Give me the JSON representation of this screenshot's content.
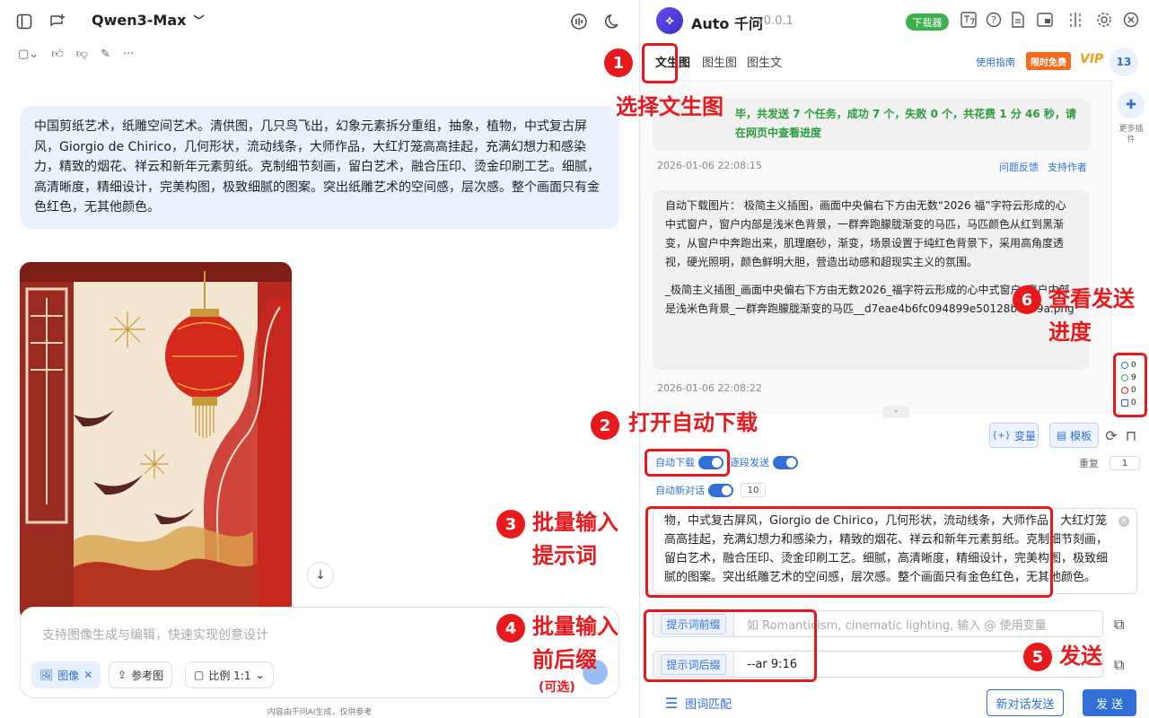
{
  "left": {
    "model": "Qwen3-Max",
    "user_prompt": "中国剪纸艺术，纸雕空间艺术。清供图，几只鸟飞出，幻象元素拆分重组，抽象，植物，中式复古屏风，Giorgio de Chirico，几何形状，流动线条，大师作品，大红灯笼高高挂起，充满幻想力和感染力，精致的烟花、祥云和新年元素剪纸。克制细节刻画，留白艺术，融合压印、烫金印刷工艺。细腻，高清晰度，精细设计，完美构图，极致细腻的图案。突出纸雕艺术的空间感，层次感。整个画面只有金色红色，无其他颜色。",
    "composer_placeholder": "支持图像生成与编辑，快速实现创意设计",
    "chips": {
      "image": "图像",
      "reference": "参考图",
      "ratio": "比例 1:1"
    },
    "footer": "内容由千问AI生成，仅供参考"
  },
  "panel": {
    "title": "Auto 千问",
    "version": "v0.0.1",
    "downloader": "下载器",
    "tabs": [
      "文生图",
      "图生图",
      "图生文"
    ],
    "guide": "使用指南",
    "free": "限时免费",
    "vip": "VIP",
    "count": "13",
    "rail_label": "更多插件",
    "log": {
      "result_text": "毕，共发送 7 个任务，成功 7 个，失败 0 个，共花费 1 分 46 秒，请在网页中查看进度",
      "ts1": "2026-01-06 22:08:15",
      "feedback": "问题反馈",
      "support": "支持作者",
      "download_msg": "自动下载图片： 极简主义插图，画面中央偏右下方由无数“2026 福”字符云形成的心中式窗户，窗户内部是浅米色背景，一群奔跑朦胧渐变的马匹，马匹颜色从红到黑渐变，从窗户中奔跑出来，肌理磨砂，渐变，场景设置于纯红色背景下，采用高角度透视，硬光照明，颜色鲜明大胆，营造出动感和超现实主义的氛围。",
      "filename": "_极简主义插图_画面中央偏右下方由无数2026_福字符云形成的心中式窗户_窗户内部是浅米色背景_一群奔跑朦胧渐变的马匹__d7eae4b6fc094899e50128bc199a.png",
      "ts2": "2026-01-06 22:08:22"
    },
    "status": {
      "pending": "0",
      "success": "9",
      "failed": "0",
      "docs": "0"
    },
    "controls": {
      "variable": "变量",
      "template": "模板",
      "auto_download": "自动下载",
      "segment_send": "逐段发送",
      "repeat_label": "重复",
      "repeat_value": "1",
      "auto_new_chat": "自动新对话",
      "auto_new_value": "10",
      "prompt_text": "物，中式复古屏风，Giorgio de Chirico，几何形状，流动线条，大师作品，大红灯笼高高挂起，充满幻想力和感染力，精致的烟花、祥云和新年元素剪纸。克制细节刻画，留白艺术，融合压印、烫金印刷工艺。细腻，高清晰度，精细设计，完美构图，极致细腻的图案。突出纸雕艺术的空间感，层次感。整个画面只有金色红色，无其他颜色。",
      "prompt_tail": "颜色。",
      "prefix_label": "提示词前缀",
      "prefix_placeholder": "如 Romanticism, cinematic lighting, 输入 @ 使用变量",
      "suffix_label": "提示词后缀",
      "suffix_value": "--ar 9:16",
      "match": "图词匹配",
      "new_chat_send": "新对话发送",
      "send": "发 送"
    }
  },
  "annotations": {
    "s1": "1",
    "n1": "选择文生图",
    "s2": "2",
    "n2": "打开自动下载",
    "s3": "3",
    "n3a": "批量输入",
    "n3b": "提示词",
    "s4": "4",
    "n4a": "批量输入",
    "n4b": "前后缀",
    "n4c": "(可选)",
    "s5": "5",
    "n5": "发送",
    "s6": "6",
    "n6a": "查看发送",
    "n6b": "进度"
  },
  "colors": {
    "accent": "#2f6fd6",
    "annotation": "#e8191c",
    "success": "#3bb04c",
    "free": "#f46a1e"
  }
}
